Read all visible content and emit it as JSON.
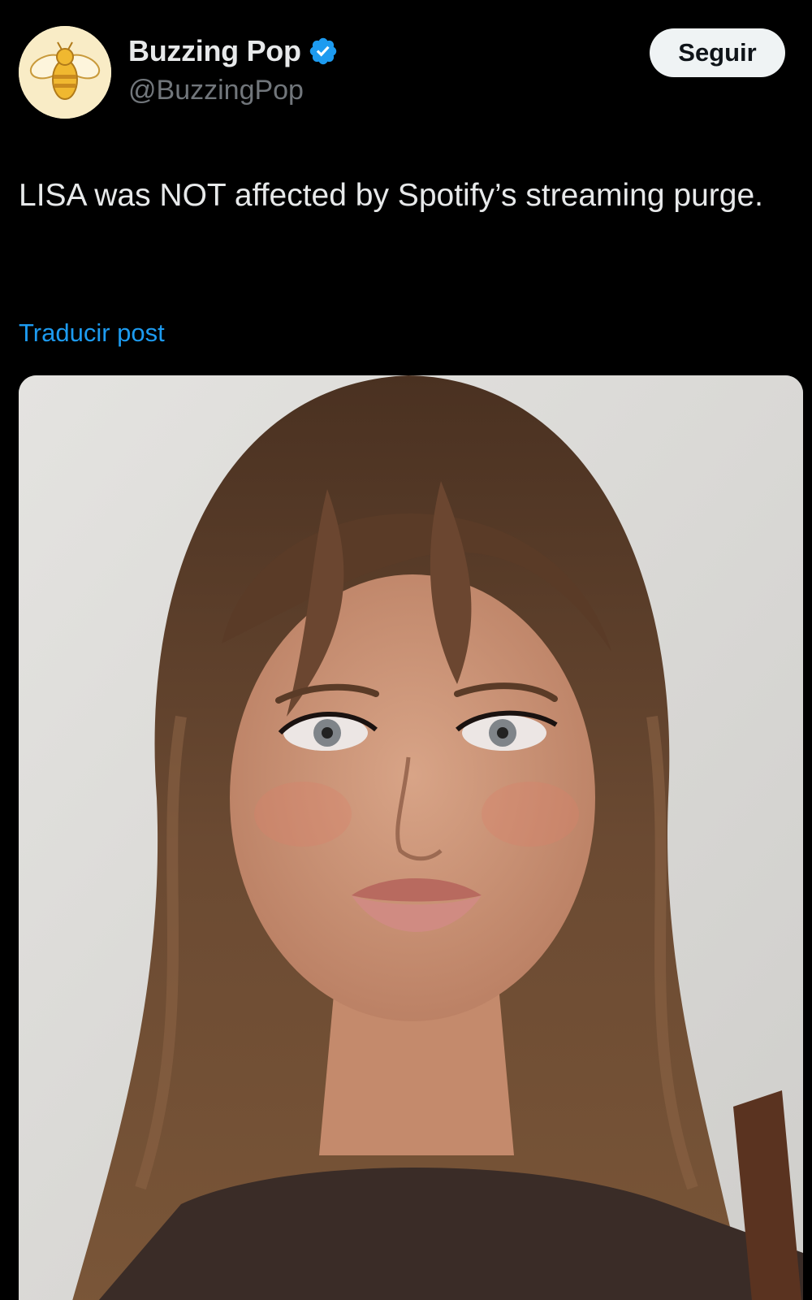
{
  "post": {
    "author": {
      "display_name": "Buzzing Pop",
      "handle": "@BuzzingPop",
      "verified": true,
      "avatar_icon": "bee-icon"
    },
    "follow_label": "Seguir",
    "text": "LISA was NOT affected by Spotify’s streaming purge.",
    "translate_label": "Traducir post",
    "media": {
      "type": "photo"
    }
  },
  "colors": {
    "background": "#000000",
    "text_primary": "#e7e9ea",
    "text_secondary": "#71767b",
    "link": "#1d9bf0",
    "verified": "#1d9bf0",
    "follow_bg": "#eff3f4"
  }
}
